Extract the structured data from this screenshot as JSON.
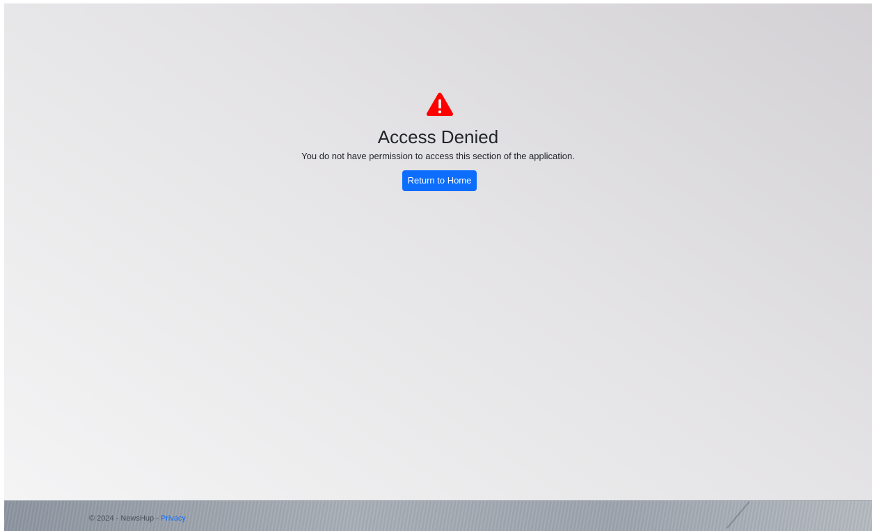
{
  "main": {
    "icon": "warning-triangle-icon",
    "title": "Access Denied",
    "message": "You do not have permission to access this section of the application.",
    "button_label": "Return to Home"
  },
  "footer": {
    "copyright": "© 2024 - NewsHup - ",
    "privacy_link": "Privacy"
  },
  "colors": {
    "warning": "#ff0000",
    "button": "#0d6efd",
    "link": "#0d6efd"
  }
}
